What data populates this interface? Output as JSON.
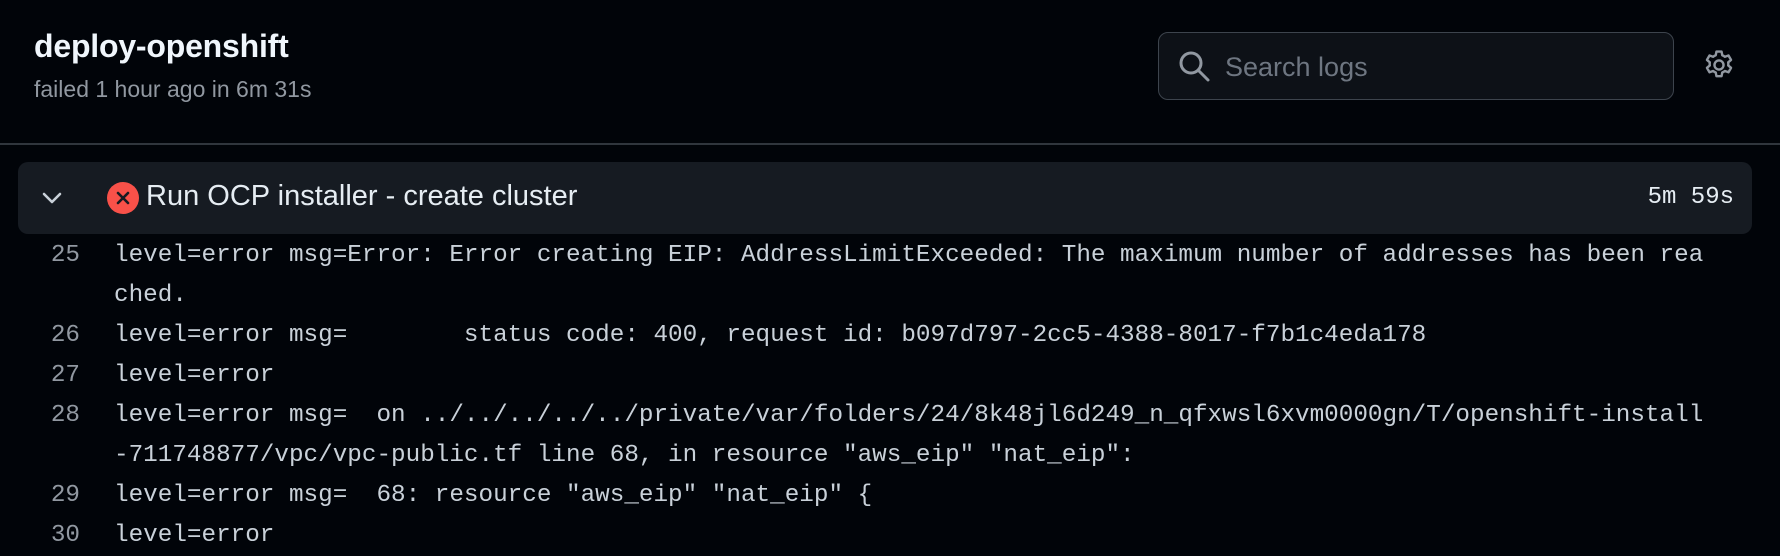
{
  "job": {
    "title": "deploy-openshift",
    "status": "failed 1 hour ago in 6m 31s"
  },
  "search": {
    "placeholder": "Search logs",
    "value": ""
  },
  "icons": {
    "search": "search-icon",
    "settings": "gear-icon",
    "expand": "chevron-down-icon",
    "status": "x-circle-fill-icon"
  },
  "colors": {
    "background": "#010409",
    "step_background": "#161b22",
    "fail": "#f85149",
    "muted": "#9198a1"
  },
  "step": {
    "title": "Run OCP installer - create cluster",
    "duration": "5m 59s",
    "status": "failed"
  },
  "log_lines": [
    {
      "num": "25",
      "text": "level=error msg=Error: Error creating EIP: AddressLimitExceeded: The maximum number of addresses has been reached."
    },
    {
      "num": "26",
      "text": "level=error msg=        status code: 400, request id: b097d797-2cc5-4388-8017-f7b1c4eda178"
    },
    {
      "num": "27",
      "text": "level=error"
    },
    {
      "num": "28",
      "text": "level=error msg=  on ../../../../../private/var/folders/24/8k48jl6d249_n_qfxwsl6xvm0000gn/T/openshift-install-711748877/vpc/vpc-public.tf line 68, in resource \"aws_eip\" \"nat_eip\":"
    },
    {
      "num": "29",
      "text": "level=error msg=  68: resource \"aws_eip\" \"nat_eip\" {"
    },
    {
      "num": "30",
      "text": "level=error"
    }
  ]
}
